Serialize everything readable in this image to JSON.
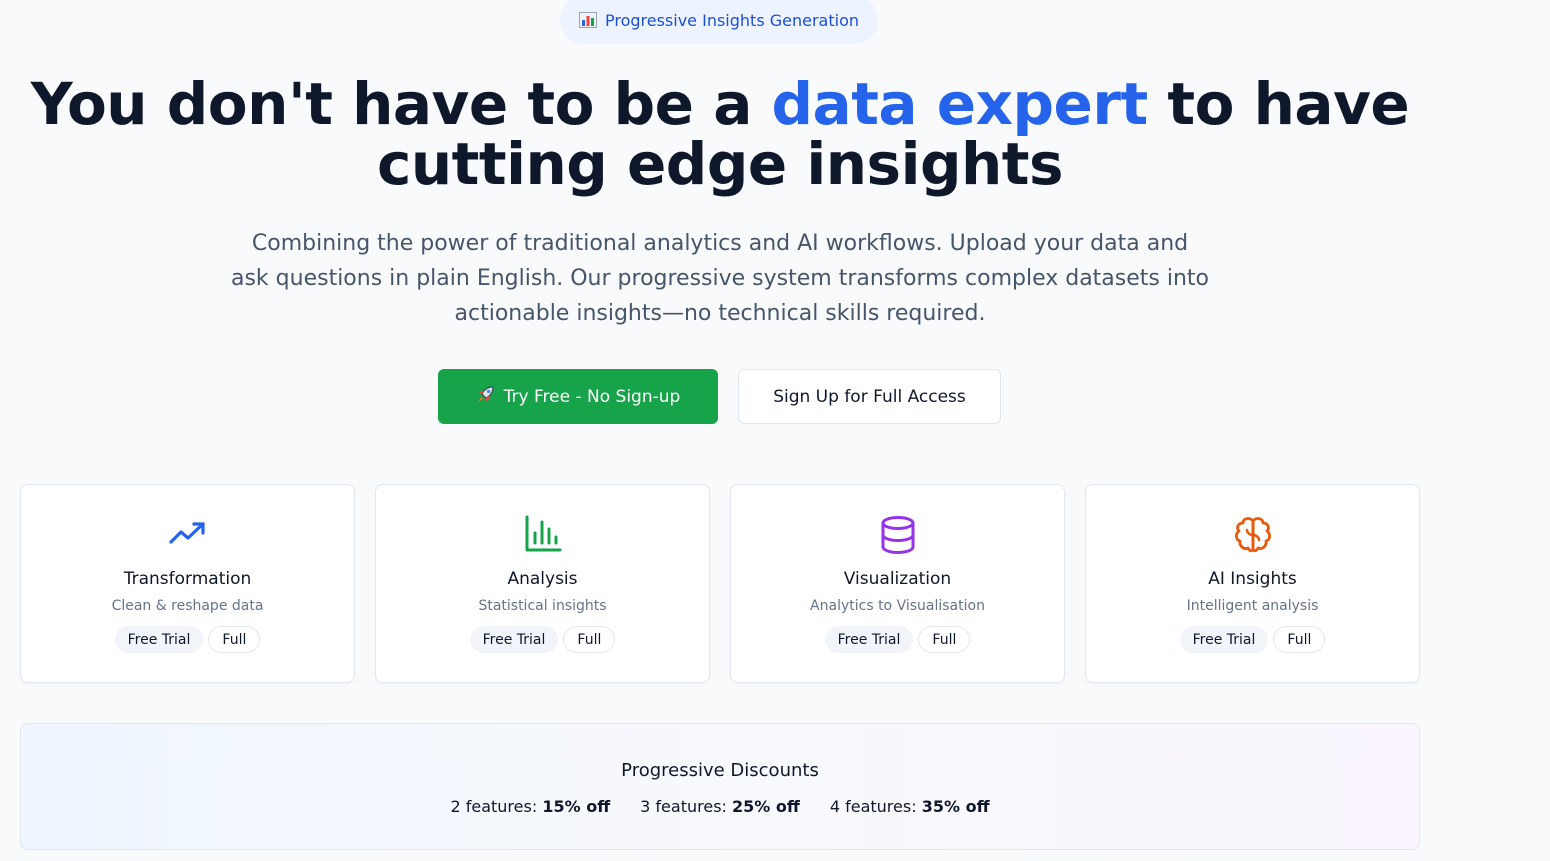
{
  "badge": {
    "icon": "bar-chart-emoji-icon",
    "label": "Progressive Insights Generation"
  },
  "hero": {
    "title_prefix": "You don't have to be a ",
    "title_accent": "data expert",
    "title_suffix": " to have cutting edge insights",
    "subtitle": "Combining the power of traditional analytics and AI workflows. Upload your data and ask questions in plain English. Our progressive system transforms complex datasets into actionable insights—no technical skills required.",
    "accent_color": "#2563eb"
  },
  "buttons": {
    "primary": {
      "icon": "rocket-icon",
      "label": "Try Free - No Sign-up",
      "color": "#16a34a"
    },
    "secondary": {
      "label": "Sign Up for Full Access"
    }
  },
  "features": [
    {
      "icon": "trending-up-icon",
      "icon_color": "#2563eb",
      "title": "Transformation",
      "description": "Clean & reshape data",
      "tags": [
        "Free Trial",
        "Full"
      ]
    },
    {
      "icon": "bar-chart-icon",
      "icon_color": "#16a34a",
      "title": "Analysis",
      "description": "Statistical insights",
      "tags": [
        "Free Trial",
        "Full"
      ]
    },
    {
      "icon": "database-icon",
      "icon_color": "#9333ea",
      "title": "Visualization",
      "description": "Analytics to Visualisation",
      "tags": [
        "Free Trial",
        "Full"
      ]
    },
    {
      "icon": "brain-icon",
      "icon_color": "#ea580c",
      "title": "AI Insights",
      "description": "Intelligent analysis",
      "tags": [
        "Free Trial",
        "Full"
      ]
    }
  ],
  "discounts": {
    "title": "Progressive Discounts",
    "tiers": [
      {
        "label": "2 features:",
        "value": "15% off"
      },
      {
        "label": "3 features:",
        "value": "25% off"
      },
      {
        "label": "4 features:",
        "value": "35% off"
      }
    ]
  }
}
